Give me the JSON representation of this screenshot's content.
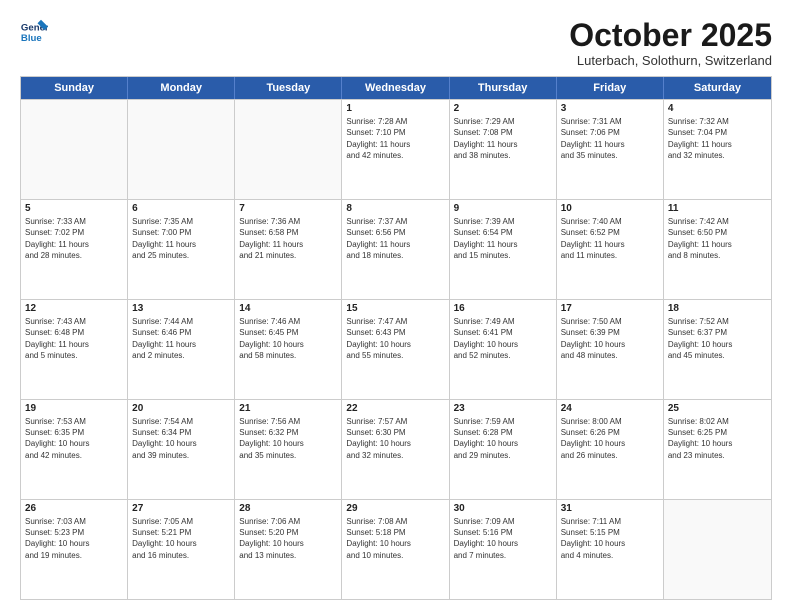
{
  "header": {
    "logo_line1": "General",
    "logo_line2": "Blue",
    "month": "October 2025",
    "location": "Luterbach, Solothurn, Switzerland"
  },
  "weekdays": [
    "Sunday",
    "Monday",
    "Tuesday",
    "Wednesday",
    "Thursday",
    "Friday",
    "Saturday"
  ],
  "rows": [
    [
      {
        "day": "",
        "text": ""
      },
      {
        "day": "",
        "text": ""
      },
      {
        "day": "",
        "text": ""
      },
      {
        "day": "1",
        "text": "Sunrise: 7:28 AM\nSunset: 7:10 PM\nDaylight: 11 hours\nand 42 minutes."
      },
      {
        "day": "2",
        "text": "Sunrise: 7:29 AM\nSunset: 7:08 PM\nDaylight: 11 hours\nand 38 minutes."
      },
      {
        "day": "3",
        "text": "Sunrise: 7:31 AM\nSunset: 7:06 PM\nDaylight: 11 hours\nand 35 minutes."
      },
      {
        "day": "4",
        "text": "Sunrise: 7:32 AM\nSunset: 7:04 PM\nDaylight: 11 hours\nand 32 minutes."
      }
    ],
    [
      {
        "day": "5",
        "text": "Sunrise: 7:33 AM\nSunset: 7:02 PM\nDaylight: 11 hours\nand 28 minutes."
      },
      {
        "day": "6",
        "text": "Sunrise: 7:35 AM\nSunset: 7:00 PM\nDaylight: 11 hours\nand 25 minutes."
      },
      {
        "day": "7",
        "text": "Sunrise: 7:36 AM\nSunset: 6:58 PM\nDaylight: 11 hours\nand 21 minutes."
      },
      {
        "day": "8",
        "text": "Sunrise: 7:37 AM\nSunset: 6:56 PM\nDaylight: 11 hours\nand 18 minutes."
      },
      {
        "day": "9",
        "text": "Sunrise: 7:39 AM\nSunset: 6:54 PM\nDaylight: 11 hours\nand 15 minutes."
      },
      {
        "day": "10",
        "text": "Sunrise: 7:40 AM\nSunset: 6:52 PM\nDaylight: 11 hours\nand 11 minutes."
      },
      {
        "day": "11",
        "text": "Sunrise: 7:42 AM\nSunset: 6:50 PM\nDaylight: 11 hours\nand 8 minutes."
      }
    ],
    [
      {
        "day": "12",
        "text": "Sunrise: 7:43 AM\nSunset: 6:48 PM\nDaylight: 11 hours\nand 5 minutes."
      },
      {
        "day": "13",
        "text": "Sunrise: 7:44 AM\nSunset: 6:46 PM\nDaylight: 11 hours\nand 2 minutes."
      },
      {
        "day": "14",
        "text": "Sunrise: 7:46 AM\nSunset: 6:45 PM\nDaylight: 10 hours\nand 58 minutes."
      },
      {
        "day": "15",
        "text": "Sunrise: 7:47 AM\nSunset: 6:43 PM\nDaylight: 10 hours\nand 55 minutes."
      },
      {
        "day": "16",
        "text": "Sunrise: 7:49 AM\nSunset: 6:41 PM\nDaylight: 10 hours\nand 52 minutes."
      },
      {
        "day": "17",
        "text": "Sunrise: 7:50 AM\nSunset: 6:39 PM\nDaylight: 10 hours\nand 48 minutes."
      },
      {
        "day": "18",
        "text": "Sunrise: 7:52 AM\nSunset: 6:37 PM\nDaylight: 10 hours\nand 45 minutes."
      }
    ],
    [
      {
        "day": "19",
        "text": "Sunrise: 7:53 AM\nSunset: 6:35 PM\nDaylight: 10 hours\nand 42 minutes."
      },
      {
        "day": "20",
        "text": "Sunrise: 7:54 AM\nSunset: 6:34 PM\nDaylight: 10 hours\nand 39 minutes."
      },
      {
        "day": "21",
        "text": "Sunrise: 7:56 AM\nSunset: 6:32 PM\nDaylight: 10 hours\nand 35 minutes."
      },
      {
        "day": "22",
        "text": "Sunrise: 7:57 AM\nSunset: 6:30 PM\nDaylight: 10 hours\nand 32 minutes."
      },
      {
        "day": "23",
        "text": "Sunrise: 7:59 AM\nSunset: 6:28 PM\nDaylight: 10 hours\nand 29 minutes."
      },
      {
        "day": "24",
        "text": "Sunrise: 8:00 AM\nSunset: 6:26 PM\nDaylight: 10 hours\nand 26 minutes."
      },
      {
        "day": "25",
        "text": "Sunrise: 8:02 AM\nSunset: 6:25 PM\nDaylight: 10 hours\nand 23 minutes."
      }
    ],
    [
      {
        "day": "26",
        "text": "Sunrise: 7:03 AM\nSunset: 5:23 PM\nDaylight: 10 hours\nand 19 minutes."
      },
      {
        "day": "27",
        "text": "Sunrise: 7:05 AM\nSunset: 5:21 PM\nDaylight: 10 hours\nand 16 minutes."
      },
      {
        "day": "28",
        "text": "Sunrise: 7:06 AM\nSunset: 5:20 PM\nDaylight: 10 hours\nand 13 minutes."
      },
      {
        "day": "29",
        "text": "Sunrise: 7:08 AM\nSunset: 5:18 PM\nDaylight: 10 hours\nand 10 minutes."
      },
      {
        "day": "30",
        "text": "Sunrise: 7:09 AM\nSunset: 5:16 PM\nDaylight: 10 hours\nand 7 minutes."
      },
      {
        "day": "31",
        "text": "Sunrise: 7:11 AM\nSunset: 5:15 PM\nDaylight: 10 hours\nand 4 minutes."
      },
      {
        "day": "",
        "text": ""
      }
    ]
  ]
}
